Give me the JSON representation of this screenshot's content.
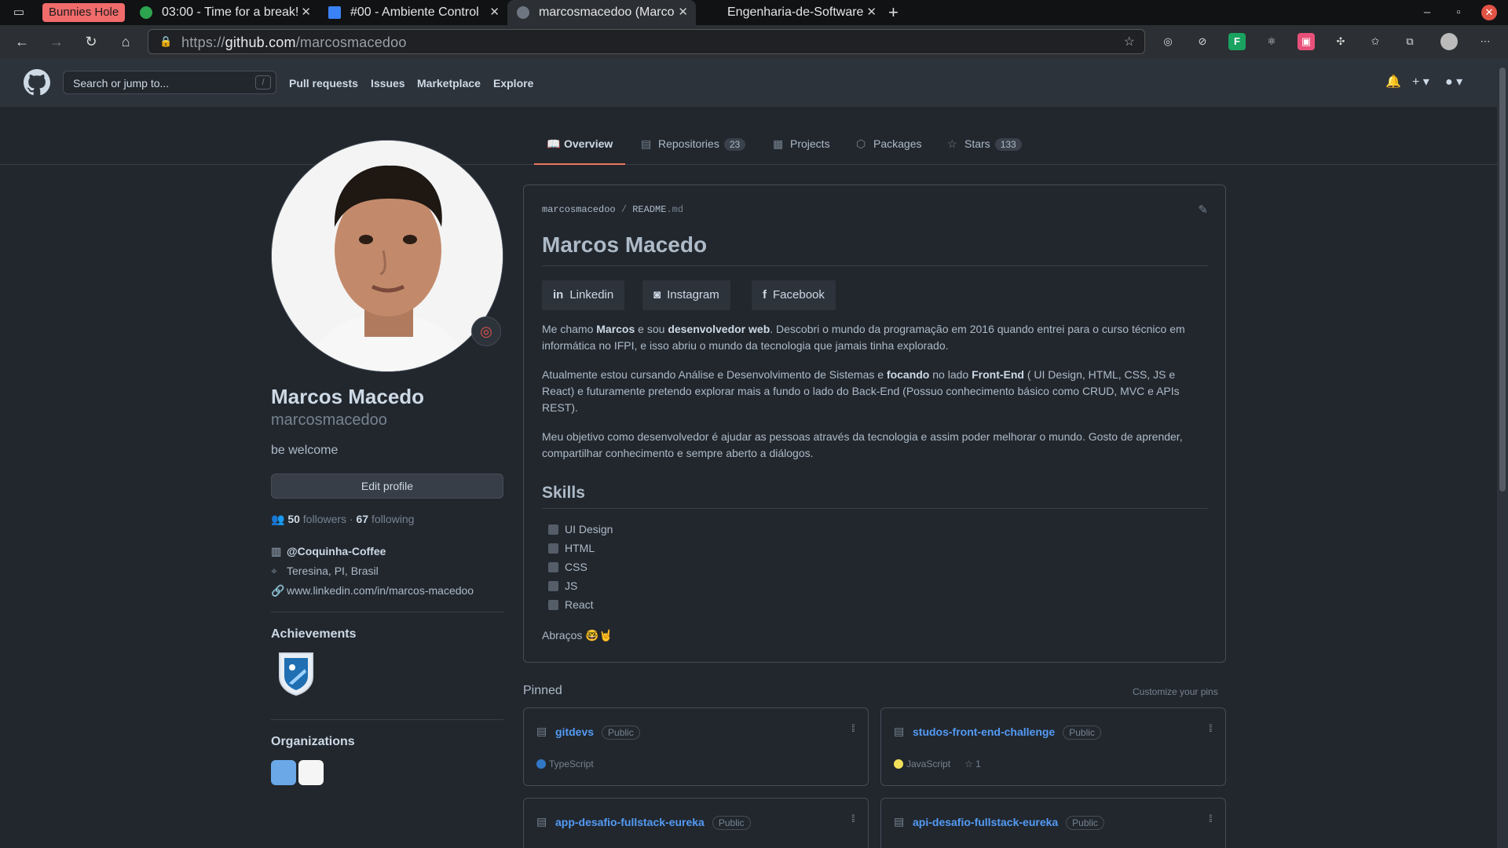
{
  "browser": {
    "tab_group": "Bunnies Hole",
    "tabs": [
      {
        "title": "03:00 - Time for a break!"
      },
      {
        "title": "#00 - Ambiente Control"
      },
      {
        "title": "marcosmacedoo (Marco"
      },
      {
        "title": "Engenharia-de-Software"
      }
    ],
    "url_prefix": "https://",
    "url_host": "github.com",
    "url_path": "/marcosmacedoo"
  },
  "header": {
    "search_placeholder": "Search or jump to...",
    "search_hotkey": "/",
    "nav": [
      "Pull requests",
      "Issues",
      "Marketplace",
      "Explore"
    ]
  },
  "profile_tabs": {
    "overview": "Overview",
    "repositories": "Repositories",
    "repositories_count": "23",
    "projects": "Projects",
    "packages": "Packages",
    "stars": "Stars",
    "stars_count": "133"
  },
  "profile": {
    "name": "Marcos Macedo",
    "username": "marcosmacedoo",
    "bio": "be welcome",
    "edit_button": "Edit profile",
    "followers_count": "50",
    "followers_label": "followers",
    "separator": "·",
    "following_count": "67",
    "following_label": "following",
    "company": "@Coquinha-Coffee",
    "location": "Teresina, PI, Brasil",
    "website": "www.linkedin.com/in/marcos-macedoo",
    "achievements_title": "Achievements",
    "organizations_title": "Organizations"
  },
  "readme": {
    "path_user": "marcosmacedoo",
    "path_sep": "/",
    "path_file": "README",
    "path_ext": ".md",
    "title": "Marcos Macedo",
    "social": [
      "Linkedin",
      "Instagram",
      "Facebook"
    ],
    "p1_a": "Me chamo ",
    "p1_b": "Marcos",
    "p1_c": " e sou ",
    "p1_d": "desenvolvedor web",
    "p1_e": ". Descobri o mundo da programação em 2016 quando entrei para o curso técnico em informática no IFPI, e isso abriu o mundo da tecnologia que jamais tinha explorado.",
    "p2_a": "Atualmente estou cursando Análise e Desenvolvimento de Sistemas e ",
    "p2_b": "focando",
    "p2_c": " no lado ",
    "p2_d": "Front-End",
    "p2_e": " ( UI Design, HTML, CSS, JS e React) e futuramente pretendo explorar mais a fundo o lado do Back-End (Possuo conhecimento básico como CRUD, MVC e APIs REST).",
    "p3": "Meu objetivo como desenvolvedor é ajudar as pessoas através da tecnologia e assim poder melhorar o mundo. Gosto de aprender, compartilhar conhecimento e sempre aberto a diálogos.",
    "skills_title": "Skills",
    "skills": [
      "UI Design",
      "HTML",
      "CSS",
      "JS",
      "React"
    ],
    "closing": "Abraços 🤓🤘"
  },
  "pinned": {
    "title": "Pinned",
    "customize": "Customize your pins",
    "visibility": "Public",
    "repos": [
      {
        "name": "gitdevs",
        "language": "TypeScript",
        "lang_color": "#3178c6",
        "stars": ""
      },
      {
        "name": "studos-front-end-challenge",
        "language": "JavaScript",
        "lang_color": "#f1e05a",
        "stars": "1"
      },
      {
        "name": "app-desafio-fullstack-eureka",
        "language": "",
        "lang_color": "",
        "stars": ""
      },
      {
        "name": "api-desafio-fullstack-eureka",
        "language": "",
        "lang_color": "",
        "stars": ""
      }
    ]
  }
}
